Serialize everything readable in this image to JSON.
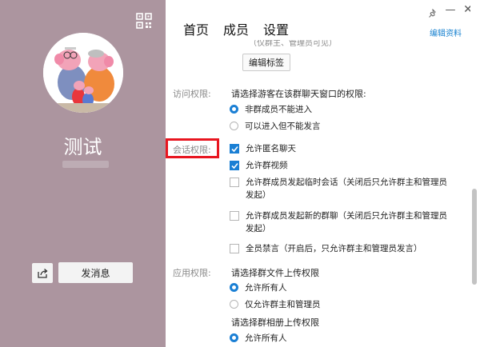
{
  "profile": {
    "group_name": "测试",
    "message_button": "发消息"
  },
  "header": {
    "tabs": [
      "首页",
      "成员",
      "设置"
    ],
    "edit_profile": "编辑资料"
  },
  "icons": {
    "qr": "qr-code-icon",
    "share": "share-icon",
    "pin": "pin-icon",
    "minimize": "minimize-icon",
    "close": "close-icon"
  },
  "settings": {
    "cut_text": "（仅群主、管理员可见）",
    "edit_tags": "编辑标签",
    "access": {
      "label": "访问权限:",
      "prompt": "请选择游客在该群聊天窗口的权限:",
      "options": [
        "非群成员不能进入",
        "可以进入但不能发言"
      ],
      "selected": 0
    },
    "session": {
      "label": "会话权限:",
      "options": [
        {
          "text": "允许匿名聊天",
          "checked": true
        },
        {
          "text": "允许群视频",
          "checked": true
        },
        {
          "text": "允许群成员发起临时会话（关闭后只允许群主和管理员发起）",
          "checked": false
        },
        {
          "text": "允许群成员发起新的群聊（关闭后只允许群主和管理员发起）",
          "checked": false
        },
        {
          "text": "全员禁言（开启后，只允许群主和管理员发言）",
          "checked": false
        }
      ]
    },
    "app": {
      "label": "应用权限:",
      "file_prompt": "请选择群文件上传权限",
      "file_options": [
        "允许所有人",
        "仅允许群主和管理员"
      ],
      "file_selected": 0,
      "album_prompt": "请选择群相册上传权限",
      "album_options": [
        "允许所有人"
      ],
      "album_selected": 0
    }
  },
  "colors": {
    "sidebar_bg": "#ac959f",
    "accent": "#1a7fd4",
    "highlight": "#e81620",
    "link": "#1a83d0"
  }
}
